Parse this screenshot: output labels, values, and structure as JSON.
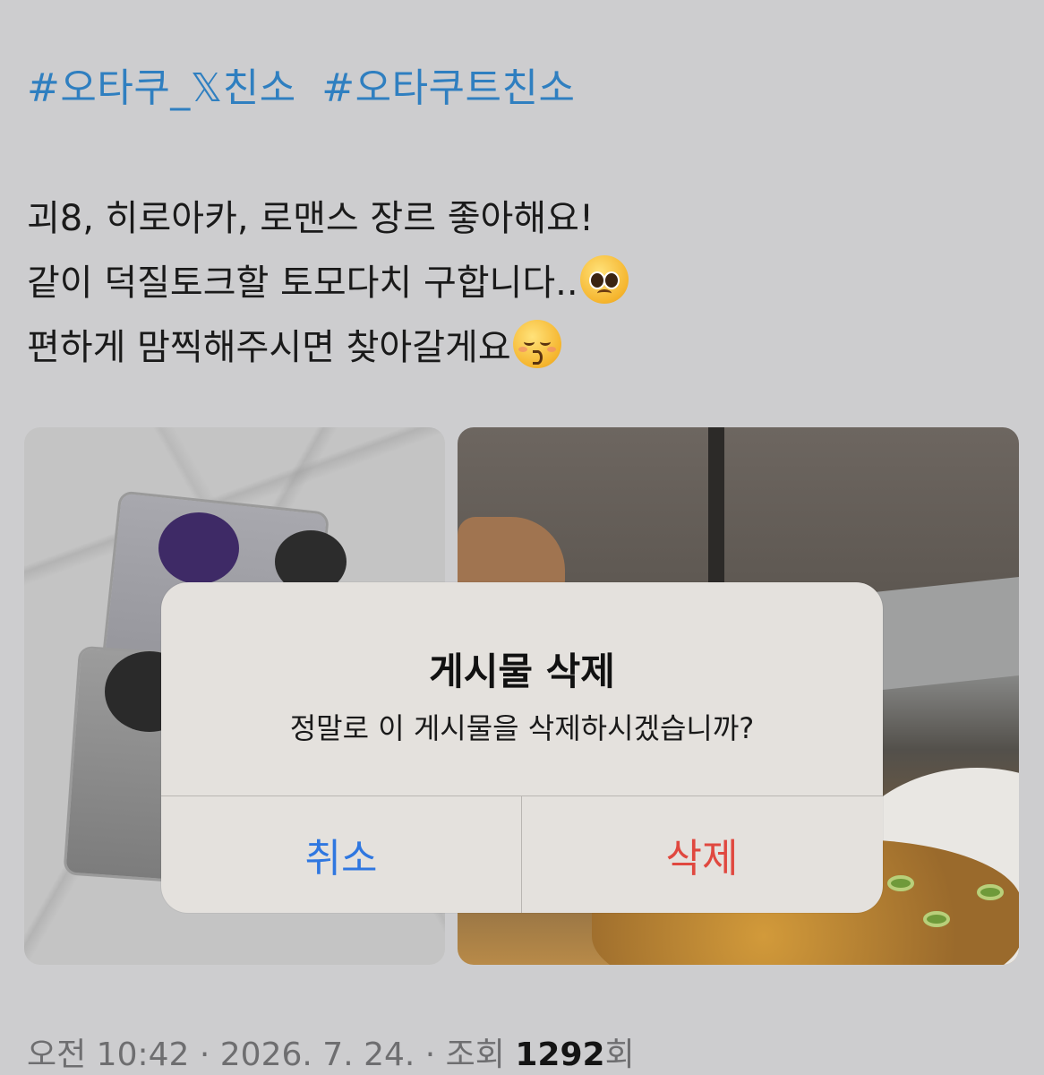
{
  "post": {
    "hashtags": [
      "#오타쿠_𝕏친소",
      "#오타쿠트친소"
    ],
    "lines": [
      "괴8, 히로아카, 로맨스 장르 좋아해요!",
      "같이 덕질토크할 토모다치 구합니다..",
      "편하게 맘찍해주시면 찾아갈게요"
    ],
    "emojis": [
      "pleading-face-emoji",
      "kissing-face-emoji"
    ],
    "meta": {
      "time": "오전 10:42",
      "separator": " · ",
      "date": "2026. 7. 24.",
      "views_label": "조회",
      "views_count": "1292",
      "views_suffix": "회"
    }
  },
  "dialog": {
    "title": "게시물 삭제",
    "message": "정말로 이 게시물을 삭제하시겠습니까?",
    "cancel_label": "취소",
    "delete_label": "삭제"
  },
  "colors": {
    "hashtag": "#2f7fc0",
    "cancel": "#2f77e0",
    "delete": "#e0483f",
    "background": "#cdcdcf",
    "dialog_bg": "#e4e1dd"
  }
}
